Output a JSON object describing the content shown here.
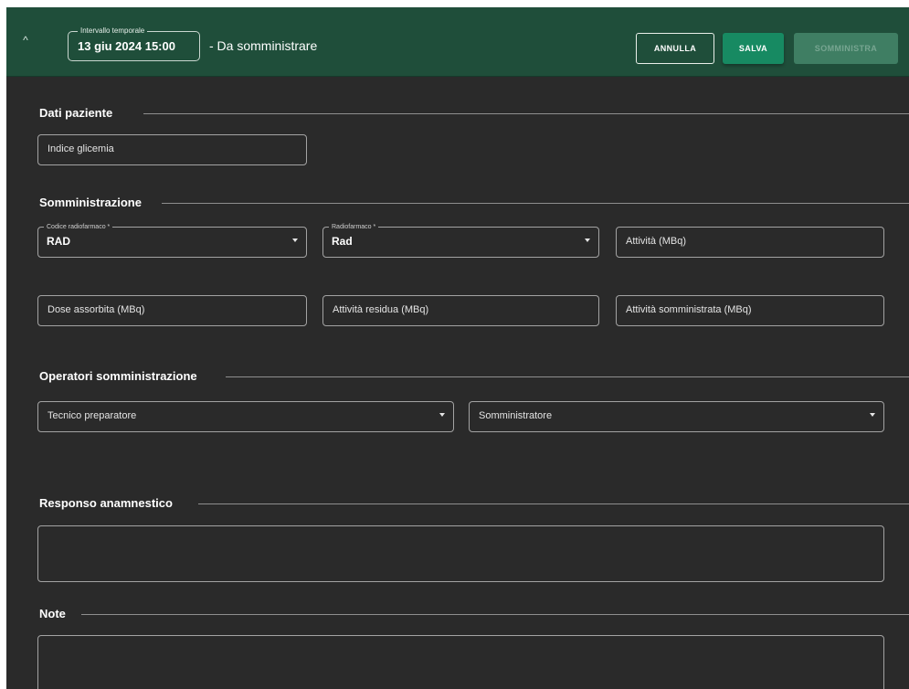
{
  "header": {
    "collapse_icon": "^",
    "interval_label": "Intervallo temporale",
    "interval_value": "13 giu 2024 15:00",
    "title": "- Da somministrare",
    "buttons": {
      "annulla": "ANNULLA",
      "salva": "SALVA",
      "somministra": "SOMMINISTRA"
    }
  },
  "sections": {
    "dati_paziente": {
      "title": "Dati paziente",
      "indice_glicemia_placeholder": "Indice glicemia"
    },
    "somministrazione": {
      "title": "Somministrazione",
      "codice_radiofarmaco_label": "Codice radiofarmaco *",
      "codice_radiofarmaco_value": "RAD",
      "radiofarmaco_label": "Radiofarmaco *",
      "radiofarmaco_value": "Rad",
      "attivita_placeholder": "Attività (MBq)",
      "dose_assorbita_placeholder": "Dose assorbita (MBq)",
      "attivita_residua_placeholder": "Attività residua (MBq)",
      "attivita_somministrata_placeholder": "Attività somministrata (MBq)"
    },
    "operatori": {
      "title": "Operatori somministrazione",
      "tecnico_placeholder": "Tecnico preparatore",
      "somministratore_placeholder": "Somministratore"
    },
    "responso": {
      "title": "Responso anamnestico"
    },
    "note": {
      "title": "Note"
    }
  },
  "colors": {
    "header_bg": "#1f4e3a",
    "panel_bg": "#2a2a2a",
    "primary_button": "#178a62",
    "disabled_button": "#3f7e63"
  },
  "icons": {
    "collapse": "chevron-up-icon",
    "dropdown": "caret-down-icon"
  }
}
